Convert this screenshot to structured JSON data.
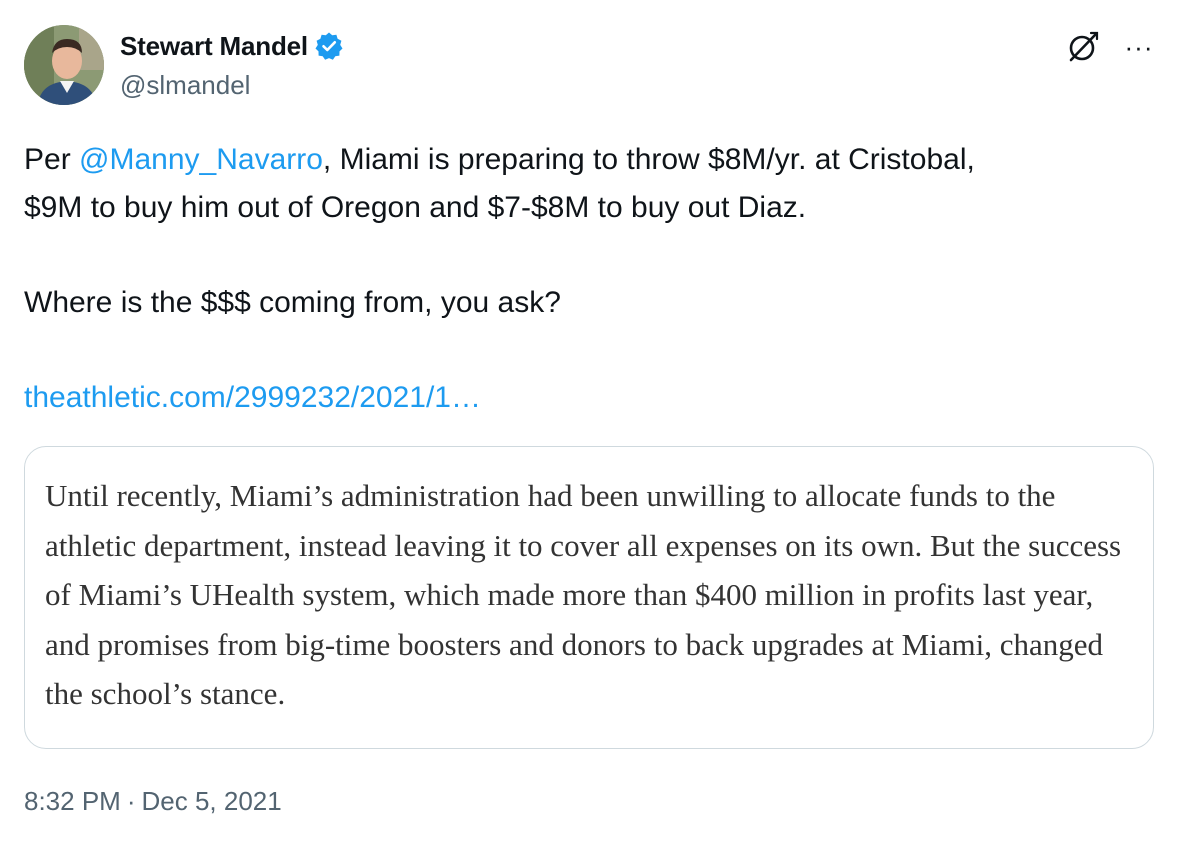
{
  "author": {
    "display_name": "Stewart Mandel",
    "handle": "@slmandel",
    "verified": true
  },
  "actions": {
    "grok_icon": "grok-icon",
    "more_icon": "more-icon",
    "more_label": "···"
  },
  "tweet": {
    "prefix": "Per ",
    "mention": "@Manny_Navarro",
    "line1_rest": ", Miami is preparing to throw $8M/yr. at Cristobal,",
    "line2": "$9M to buy him out of Oregon and $7-$8M to buy out Diaz.",
    "line3": "Where is the $$$ coming from, you ask?",
    "link": "theathletic.com/2999232/2021/1…"
  },
  "quote_card": {
    "text": "Until recently, Miami’s administration had been unwilling to allocate funds to the athletic department, instead leaving it to cover all expenses on its own. But the success of Miami’s UHealth system, which made more than $400 million in profits last year, and promises from big-time boosters and donors to back upgrades at Miami, changed the school’s stance."
  },
  "timestamp": {
    "time": "8:32 PM",
    "separator": "·",
    "date": "Dec 5, 2021"
  },
  "colors": {
    "link": "#1d9bf0",
    "verified_badge": "#1d9bf0",
    "secondary_text": "#536471",
    "border": "#cfd9de"
  }
}
